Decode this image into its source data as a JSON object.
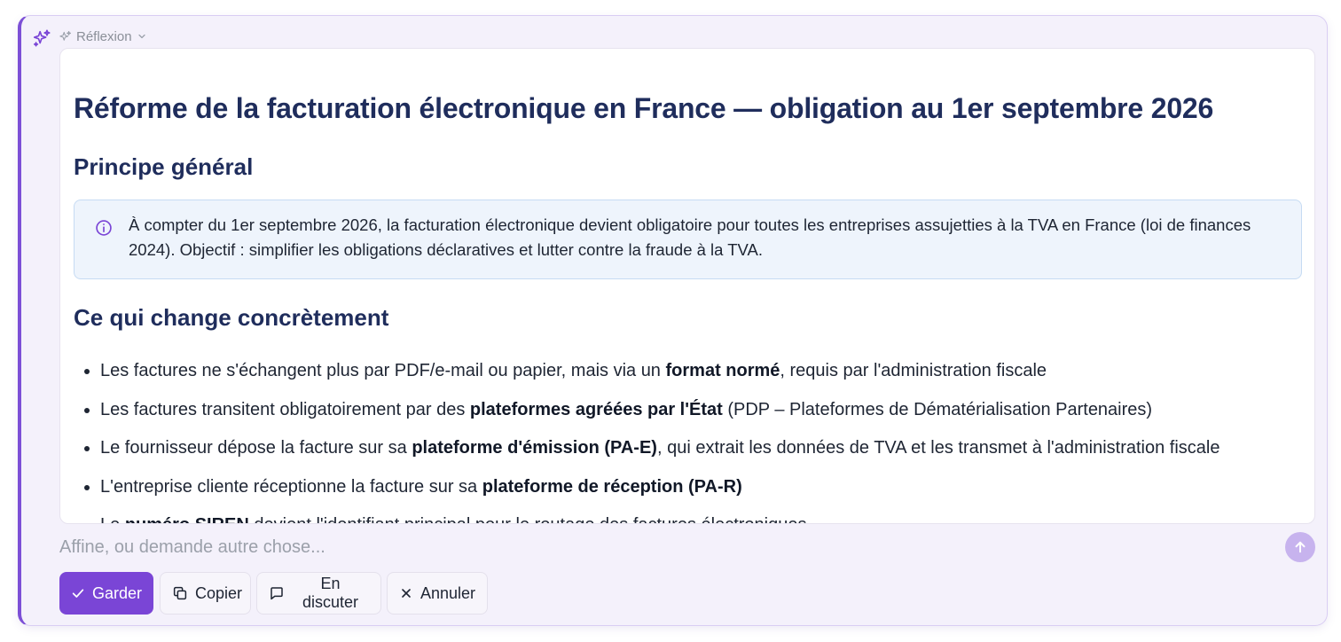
{
  "colors": {
    "accent": "#7a45d6",
    "heading": "#1f2d5c",
    "info_bg": "#eef4fc",
    "info_border": "#c6dbf3",
    "panel_bg": "#f4f1fb"
  },
  "header": {
    "label": "Réflexion",
    "icons": [
      "sparkles-icon",
      "sparkle-small-icon",
      "chevron-down-icon"
    ]
  },
  "document": {
    "title": "Réforme de la facturation électronique en France — obligation au 1er septembre 2026",
    "section1_heading": "Principe général",
    "info_text": "À compter du 1er septembre 2026, la facturation électronique devient obligatoire pour toutes les entreprises assujetties à la TVA en France (loi de finances 2024). Objectif : simplifier les obligations déclaratives et lutter contre la fraude à la TVA.",
    "section2_heading": "Ce qui change concrètement",
    "bullets": [
      {
        "before": "Les factures ne s'échangent plus par PDF/e-mail ou papier, mais via un ",
        "bold": "format normé",
        "after": ", requis par l'administration fiscale"
      },
      {
        "before": "Les factures transitent obligatoirement par des ",
        "bold": "plateformes agréées par l'État",
        "after": " (PDP – Plateformes de Dématérialisation Partenaires)"
      },
      {
        "before": "Le fournisseur dépose la facture sur sa ",
        "bold": "plateforme d'émission (PA-E)",
        "after": ", qui extrait les données de TVA et les transmet à l'administration fiscale"
      },
      {
        "before": "L'entreprise cliente réceptionne la facture sur sa ",
        "bold": "plateforme de réception (PA-R)",
        "after": ""
      },
      {
        "before": "Le ",
        "bold": "numéro SIREN",
        "after": " devient l'identifiant principal pour le routage des factures électroniques"
      }
    ]
  },
  "prompt": {
    "placeholder": "Affine, ou demande autre chose...",
    "value": ""
  },
  "actions": {
    "keep": "Garder",
    "copy": "Copier",
    "discuss": "En discuter",
    "cancel": "Annuler"
  }
}
